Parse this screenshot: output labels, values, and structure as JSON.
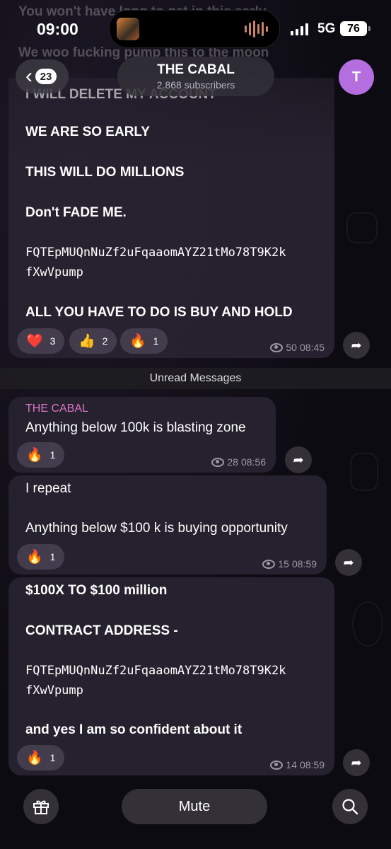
{
  "status_bar": {
    "time": "09:00",
    "network": "5G",
    "battery": "76"
  },
  "header": {
    "back_count": "23",
    "channel_title": "THE CABAL",
    "subscribers": "2.868 subscribers",
    "avatar_letter": "T",
    "avatar_color": "#b56ee0"
  },
  "ghost_lines": [
    "You won't have long to get in this early",
    "We woo fucking pump this to the moon",
    "I WILL DELETE MY ACCOUNT"
  ],
  "messages": [
    {
      "lines": [
        {
          "text": "WE ARE SO EARLY",
          "style": "bold"
        },
        {
          "text": "THIS WILL DO MILLIONS",
          "style": "bold"
        },
        {
          "text": "Don't FADE ME.",
          "style": "bold"
        },
        {
          "text": "FQTEpMUQnNuZf2uFqaaomAYZ21tMo78T9K2k\nfXwVpump",
          "style": "mono"
        },
        {
          "text": "ALL YOU HAVE TO DO IS BUY AND HOLD",
          "style": "bold"
        }
      ],
      "reactions": [
        {
          "emoji": "❤️",
          "count": "3"
        },
        {
          "emoji": "👍",
          "count": "2"
        },
        {
          "emoji": "🔥",
          "count": "1"
        }
      ],
      "views": "50",
      "time": "08:45"
    },
    {
      "sender": "THE CABAL",
      "text": "Anything below 100k is blasting zone",
      "reactions": [
        {
          "emoji": "🔥",
          "count": "1"
        }
      ],
      "views": "28",
      "time": "08:56"
    },
    {
      "text": "I repeat\n\nAnything below $100 k is buying opportunity",
      "reactions": [
        {
          "emoji": "🔥",
          "count": "1"
        }
      ],
      "views": "15",
      "time": "08:59"
    },
    {
      "lines": [
        {
          "text": "$100X TO $100 million",
          "style": "bold"
        },
        {
          "text": "CONTRACT ADDRESS -",
          "style": "bold"
        },
        {
          "text": "FQTEpMUQnNuZf2uFqaaomAYZ21tMo78T9K2k\nfXwVpump",
          "style": "mono"
        },
        {
          "text": "and yes I am so confident about it",
          "style": "bold"
        }
      ],
      "reactions": [
        {
          "emoji": "🔥",
          "count": "1"
        }
      ],
      "views": "14",
      "time": "08:59"
    }
  ],
  "unread_label": "Unread Messages",
  "bottom_bar": {
    "mute_label": "Mute",
    "gift_icon": "gift-icon",
    "search_icon": "search-icon"
  }
}
